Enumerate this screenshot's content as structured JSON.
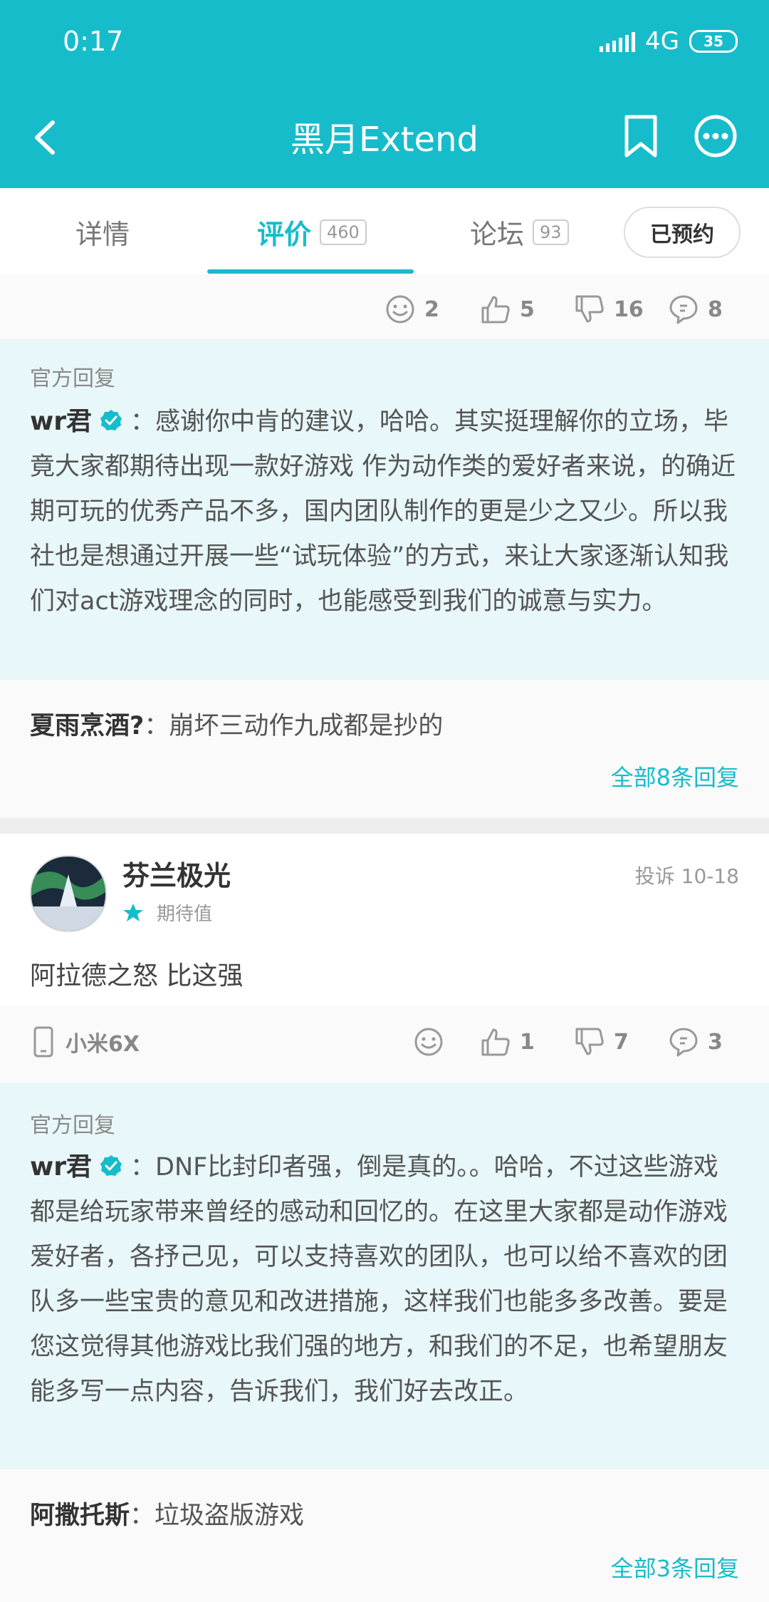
{
  "status_bar": {
    "time": "0:17",
    "network": "4G",
    "battery": "35"
  },
  "nav": {
    "title": "黑月Extend"
  },
  "tabs": [
    {
      "label": "详情",
      "count": ""
    },
    {
      "label": "评价",
      "count": "460"
    },
    {
      "label": "论坛",
      "count": "93"
    }
  ],
  "reserve_button": "已预约",
  "review1_actions": {
    "emoji": "2",
    "like": "5",
    "dislike": "16",
    "reply": "8"
  },
  "official1": {
    "label": "官方回复",
    "name": "wr君",
    "text": "：感谢你中肯的建议，哈哈。其实挺理解你的立场，毕竟大家都期待出现一款好游戏 作为动作类的爱好者来说，的确近期可玩的优秀产品不多，国内团队制作的更是少之又少。所以我社也是想通过开展一些“试玩体验”的方式，来让大家逐渐认知我们对act游戏理念的同时，也能感受到我们的诚意与实力。"
  },
  "subreply1": {
    "name": "夏雨烹酒?",
    "text": "：崩坏三动作九成都是抄的",
    "all_link": "全部8条回复"
  },
  "review2": {
    "user": "芬兰极光",
    "report": "投诉",
    "date": "10-18",
    "rating_label": "期待值",
    "text": "阿拉德之怒 比这强",
    "device": "小米6X",
    "actions": {
      "emoji": "",
      "like": "1",
      "dislike": "7",
      "reply": "3"
    }
  },
  "official2": {
    "label": "官方回复",
    "name": "wr君",
    "text": "：DNF比封印者强，倒是真的。。哈哈，不过这些游戏都是给玩家带来曾经的感动和回忆的。在这里大家都是动作游戏爱好者，各抒己见，可以支持喜欢的团队，也可以给不喜欢的团队多一些宝贵的意见和改进措施，这样我们也能多多改善。要是您这觉得其他游戏比我们强的地方，和我们的不足，也希望朋友能多写一点内容，告诉我们，我们好去改正。"
  },
  "subreply2": {
    "name": "阿撒托斯",
    "text": "：垃圾盗版游戏",
    "all_link": "全部3条回复"
  },
  "colors": {
    "accent": "#17bccb",
    "official_bg": "#e8f7f9"
  }
}
